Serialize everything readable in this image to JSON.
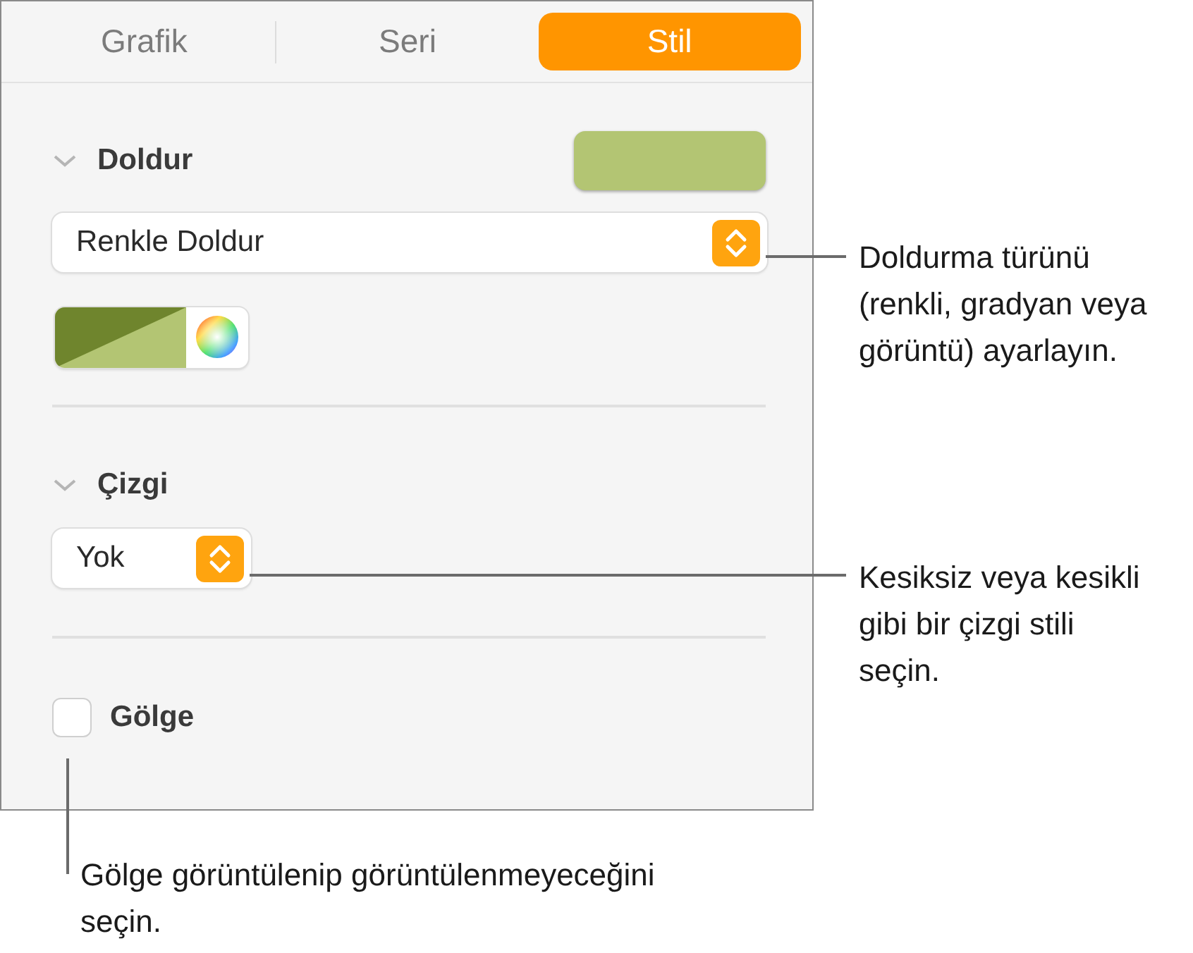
{
  "tabs": [
    {
      "label": "Grafik",
      "selected": false
    },
    {
      "label": "Seri",
      "selected": false
    },
    {
      "label": "Stil",
      "selected": true
    }
  ],
  "fill": {
    "title": "Doldur",
    "expanded": true,
    "fill_type": "Renkle Doldur"
  },
  "stroke": {
    "title": "Çizgi",
    "expanded": true,
    "style": "Yok"
  },
  "shadow": {
    "label": "Gölge",
    "checked": false
  },
  "callouts": [
    {
      "text": "Doldurma türünü (renkli, gradyan veya görüntü) ayarlayın."
    },
    {
      "text": "Kesiksiz veya kesikli gibi bir çizgi stili seçin."
    },
    {
      "text": "Gölge görüntülenip görüntülenmeyeceğini seçin."
    }
  ]
}
